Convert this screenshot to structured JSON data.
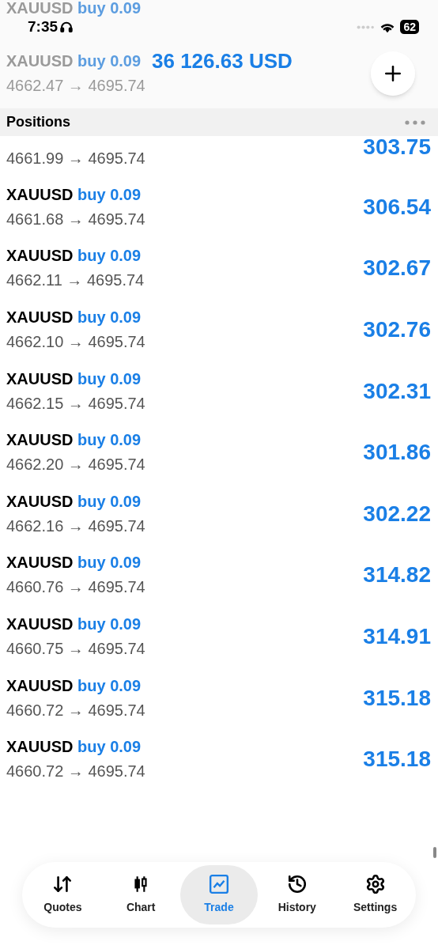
{
  "status_bar": {
    "time": "7:35",
    "battery": "62"
  },
  "faded_rows": [
    {
      "symbol": "XAUUSD",
      "order": "buy 0.09"
    },
    {
      "symbol": "XAUUSD",
      "order": "buy 0.09",
      "prices": "4662.47 → 4695.74"
    }
  ],
  "balance": "36 126.63 USD",
  "section": {
    "title": "Positions"
  },
  "positions": [
    {
      "kind": "partial",
      "prices": "4661.99 → 4695.74",
      "profit": "303.75"
    },
    {
      "kind": "full",
      "symbol": "XAUUSD",
      "order": "buy 0.09",
      "prices": "4661.68 → 4695.74",
      "profit": "306.54"
    },
    {
      "kind": "full",
      "symbol": "XAUUSD",
      "order": "buy 0.09",
      "prices": "4662.11 → 4695.74",
      "profit": "302.67"
    },
    {
      "kind": "full",
      "symbol": "XAUUSD",
      "order": "buy 0.09",
      "prices": "4662.10 → 4695.74",
      "profit": "302.76"
    },
    {
      "kind": "full",
      "symbol": "XAUUSD",
      "order": "buy 0.09",
      "prices": "4662.15 → 4695.74",
      "profit": "302.31"
    },
    {
      "kind": "full",
      "symbol": "XAUUSD",
      "order": "buy 0.09",
      "prices": "4662.20 → 4695.74",
      "profit": "301.86"
    },
    {
      "kind": "full",
      "symbol": "XAUUSD",
      "order": "buy 0.09",
      "prices": "4662.16 → 4695.74",
      "profit": "302.22"
    },
    {
      "kind": "full",
      "symbol": "XAUUSD",
      "order": "buy 0.09",
      "prices": "4660.76 → 4695.74",
      "profit": "314.82"
    },
    {
      "kind": "full",
      "symbol": "XAUUSD",
      "order": "buy 0.09",
      "prices": "4660.75 → 4695.74",
      "profit": "314.91"
    },
    {
      "kind": "full",
      "symbol": "XAUUSD",
      "order": "buy 0.09",
      "prices": "4660.72 → 4695.74",
      "profit": "315.18"
    },
    {
      "kind": "full",
      "symbol": "XAUUSD",
      "order": "buy 0.09",
      "prices": "4660.72 → 4695.74",
      "profit": "315.18"
    }
  ],
  "tabs": [
    {
      "label": "Quotes",
      "selected": false
    },
    {
      "label": "Chart",
      "selected": false
    },
    {
      "label": "Trade",
      "selected": true
    },
    {
      "label": "History",
      "selected": false
    },
    {
      "label": "Settings",
      "selected": false
    }
  ]
}
